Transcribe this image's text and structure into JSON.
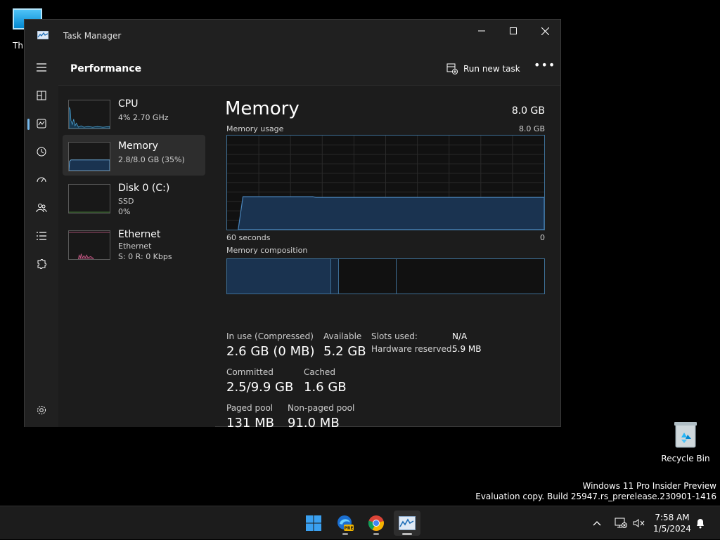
{
  "desktop": {
    "this_pc_label": "Th",
    "recycle_bin_label": "Recycle Bin",
    "watermark_line1": "Windows 11 Pro Insider Preview",
    "watermark_line2": "Evaluation copy. Build 25947.rs_prerelease.230901-1416"
  },
  "window": {
    "title": "Task Manager",
    "minimize_icon": "minimize-icon",
    "maximize_icon": "maximize-icon",
    "close_icon": "close-icon"
  },
  "nav": {
    "items": [
      {
        "icon": "hamburger-icon"
      },
      {
        "icon": "processes-icon"
      },
      {
        "icon": "performance-icon"
      },
      {
        "icon": "app-history-icon"
      },
      {
        "icon": "startup-apps-icon"
      },
      {
        "icon": "users-icon"
      },
      {
        "icon": "details-icon"
      },
      {
        "icon": "services-icon"
      },
      {
        "icon": "settings-icon"
      }
    ]
  },
  "header": {
    "title": "Performance",
    "run_task_label": "Run new task",
    "more_label": "•••"
  },
  "devices": [
    {
      "name": "CPU",
      "sub1": "4% 2.70 GHz",
      "sub2": "",
      "sub3": ""
    },
    {
      "name": "Memory",
      "sub1": "2.8/8.0 GB (35%)",
      "sub2": "",
      "sub3": ""
    },
    {
      "name": "Disk 0 (C:)",
      "sub1": "SSD",
      "sub2": "0%",
      "sub3": ""
    },
    {
      "name": "Ethernet",
      "sub1": "Ethernet",
      "sub2": "S: 0 R: 0 Kbps",
      "sub3": ""
    }
  ],
  "memory": {
    "title": "Memory",
    "total": "8.0 GB",
    "usage_label": "Memory usage",
    "usage_max": "8.0 GB",
    "time_left": "60 seconds",
    "time_right": "0",
    "composition_label": "Memory composition",
    "usage_fraction": 0.35,
    "stats": {
      "in_use_label": "In use (Compressed)",
      "in_use_value": "2.6 GB (0 MB)",
      "available_label": "Available",
      "available_value": "5.2 GB",
      "committed_label": "Committed",
      "committed_value": "2.5/9.9 GB",
      "cached_label": "Cached",
      "cached_value": "1.6 GB",
      "paged_label": "Paged pool",
      "paged_value": "131 MB",
      "nonpaged_label": "Non-paged pool",
      "nonpaged_value": "91.0 MB",
      "slots_label": "Slots used:",
      "slots_value": "N/A",
      "hw_label": "Hardware reserved:",
      "hw_value": "5.9 MB"
    }
  },
  "taskbar": {
    "apps": [
      {
        "name": "start-button"
      },
      {
        "name": "edge-beta-app"
      },
      {
        "name": "chrome-app"
      },
      {
        "name": "task-manager-app"
      }
    ],
    "time": "7:58 AM",
    "date": "1/5/2024"
  },
  "colors": {
    "accent": "#76b9ed",
    "graph_line": "#3e6f96",
    "graph_fill": "#1a3350",
    "ethernet_line": "#d35f8d"
  }
}
